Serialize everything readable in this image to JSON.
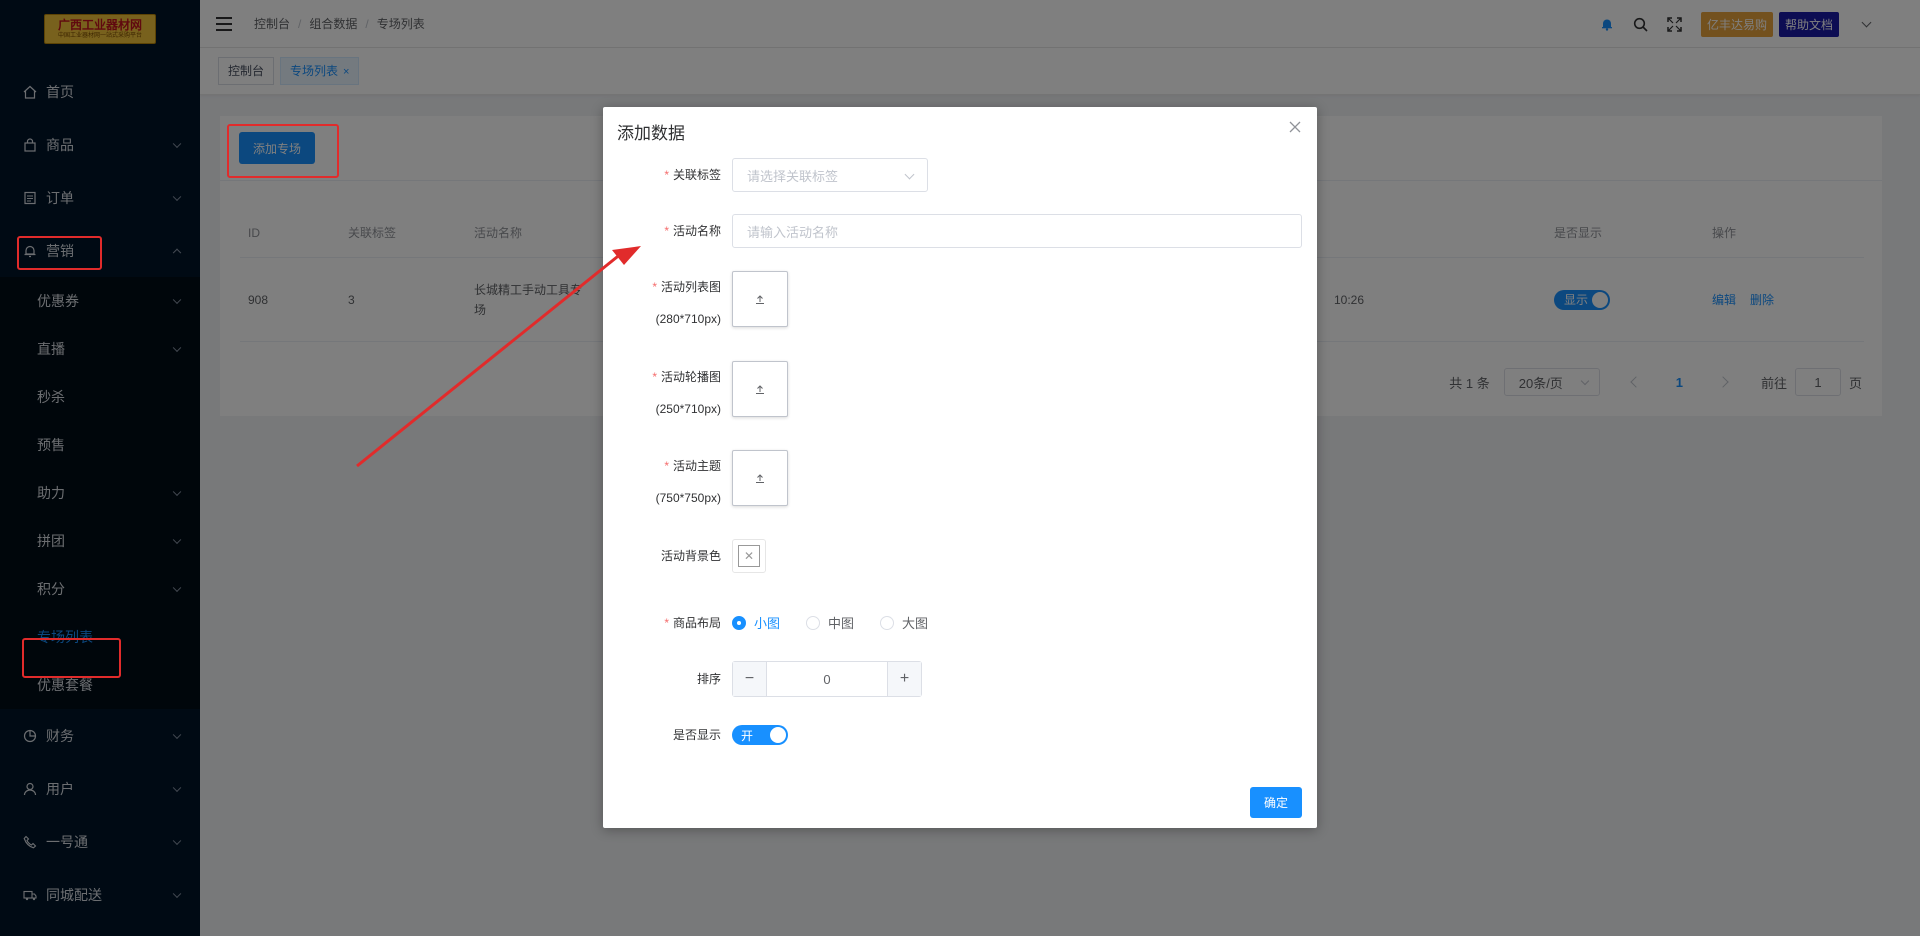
{
  "colors": {
    "primary": "#1890ff",
    "sidebar": "#001529",
    "annotation": "#e12b2b",
    "orange": "#e6a23c",
    "navy": "#1a1aa6"
  },
  "logo": {
    "title": "广西工业器材网",
    "subtitle": "中国工业器材网一站式采购平台"
  },
  "sidebar": {
    "items": [
      {
        "label": "首页",
        "icon": "home-icon"
      },
      {
        "label": "商品",
        "icon": "bag-icon"
      },
      {
        "label": "订单",
        "icon": "document-icon"
      },
      {
        "label": "营销",
        "icon": "bell-icon"
      },
      {
        "label": "财务",
        "icon": "pie-chart-icon"
      },
      {
        "label": "用户",
        "icon": "user-icon"
      },
      {
        "label": "一号通",
        "icon": "phone-icon"
      },
      {
        "label": "同城配送",
        "icon": "truck-icon"
      }
    ],
    "marketing_sub": [
      "优惠券",
      "直播",
      "秒杀",
      "预售",
      "助力",
      "拼团",
      "积分",
      "专场列表",
      "优惠套餐"
    ]
  },
  "header": {
    "breadcrumb": [
      "控制台",
      "组合数据",
      "专场列表"
    ],
    "buttons": {
      "orange": "亿丰达易购",
      "navy": "帮助文档"
    }
  },
  "tags": [
    {
      "label": "控制台"
    },
    {
      "label": "专场列表"
    }
  ],
  "main": {
    "add_button": "添加专场",
    "table": {
      "columns": [
        "ID",
        "关联标签",
        "活动名称",
        "是否显示",
        "操作"
      ],
      "rows": [
        {
          "id": "908",
          "tag": "3",
          "name": "长城精工手动工具专场",
          "time": "10:26",
          "show": "显示",
          "actions": [
            "编辑",
            "删除"
          ]
        }
      ]
    },
    "pagination": {
      "total": "共 1 条",
      "size": "20条/页",
      "current": "1",
      "goto_prefix": "前往",
      "goto_value": "1",
      "goto_suffix": "页"
    }
  },
  "modal": {
    "title": "添加数据",
    "fields": {
      "tag_label": "关联标签",
      "tag_placeholder": "请选择关联标签",
      "name_label": "活动名称",
      "name_placeholder": "请输入活动名称",
      "list_img_label": "活动列表图",
      "list_img_size": "(280*710px)",
      "banner_label": "活动轮播图",
      "banner_size": "(250*710px)",
      "theme_label": "活动主题",
      "theme_size": "(750*750px)",
      "bg_label": "活动背景色",
      "layout_label": "商品布局",
      "layout_options": [
        "小图",
        "中图",
        "大图"
      ],
      "layout_selected": "小图",
      "sort_label": "排序",
      "sort_value": "0",
      "show_label": "是否显示",
      "show_switch": "开"
    },
    "confirm": "确定"
  }
}
